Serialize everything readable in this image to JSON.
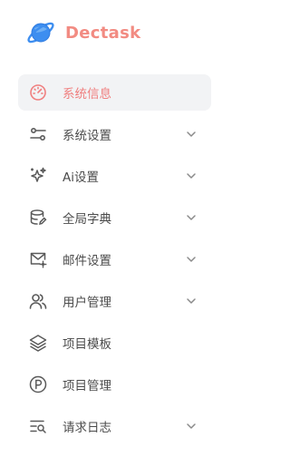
{
  "brand": {
    "name": "Dectask",
    "logo_icon": "planet-icon",
    "accent": "#f28b82"
  },
  "menu": [
    {
      "label": "系统信息",
      "icon": "dashboard-gauge-icon",
      "active": true,
      "has_submenu": false
    },
    {
      "label": "系统设置",
      "icon": "sliders-icon",
      "active": false,
      "has_submenu": true
    },
    {
      "label": "Ai设置",
      "icon": "sparkles-icon",
      "active": false,
      "has_submenu": true
    },
    {
      "label": "全局字典",
      "icon": "database-edit-icon",
      "active": false,
      "has_submenu": true
    },
    {
      "label": "邮件设置",
      "icon": "mail-settings-icon",
      "active": false,
      "has_submenu": true
    },
    {
      "label": "用户管理",
      "icon": "users-icon",
      "active": false,
      "has_submenu": true
    },
    {
      "label": "项目模板",
      "icon": "layers-icon",
      "active": false,
      "has_submenu": false
    },
    {
      "label": "项目管理",
      "icon": "circle-p-icon",
      "active": false,
      "has_submenu": false
    },
    {
      "label": "请求日志",
      "icon": "search-list-icon",
      "active": false,
      "has_submenu": true
    }
  ],
  "colors": {
    "active_bg": "#f2f3f5",
    "active_text": "#f07f7f",
    "icon": "#5a5a5a"
  }
}
